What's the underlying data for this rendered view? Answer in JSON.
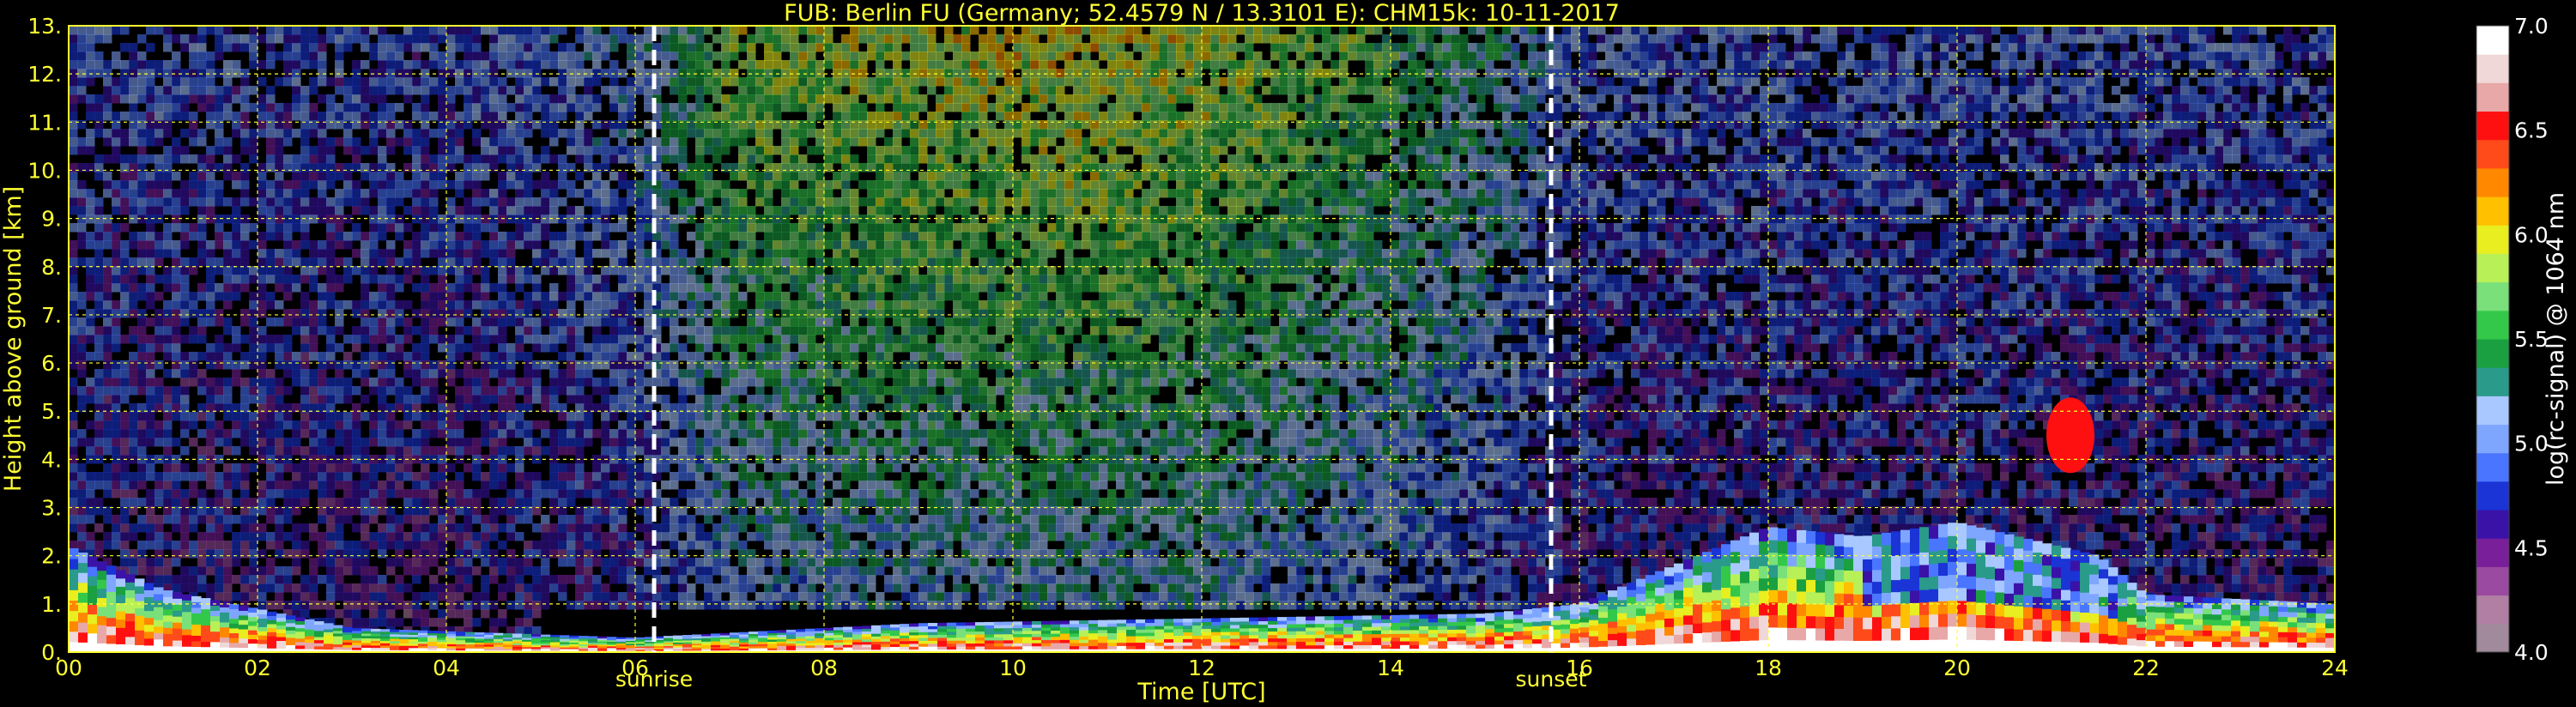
{
  "chart_data": {
    "type": "heatmap",
    "title": "FUB: Berlin FU (Germany; 52.4579 N / 13.3101 E):    CHM15k: 10-11-2017",
    "xlabel": "Time [UTC]",
    "ylabel": "Height above ground [km]",
    "xlim": [
      0,
      24
    ],
    "ylim": [
      0,
      13
    ],
    "x_ticks": [
      "00",
      "02",
      "04",
      "06",
      "08",
      "10",
      "12",
      "14",
      "16",
      "18",
      "20",
      "22",
      "24"
    ],
    "y_ticks": [
      "0.",
      "1.",
      "2.",
      "3.",
      "4.",
      "5.",
      "6.",
      "7.",
      "8.",
      "9.",
      "10.",
      "11.",
      "12.",
      "13."
    ],
    "grid": true,
    "annotations": [
      {
        "label": "sunrise",
        "x": 6.2
      },
      {
        "label": "sunset",
        "x": 15.7
      }
    ],
    "colorbar": {
      "label": "log(rc-signal) @ 1064 nm",
      "range": [
        4.0,
        7.0
      ],
      "ticks": [
        "4.0",
        "4.5",
        "5.0",
        "5.5",
        "6.0",
        "6.5",
        "7.0"
      ]
    },
    "features": {
      "noise_profile_by_hour": [
        {
          "t": 0,
          "level": 0.3
        },
        {
          "t": 4,
          "level": 0.28
        },
        {
          "t": 6,
          "level": 0.4
        },
        {
          "t": 7,
          "level": 0.78
        },
        {
          "t": 9,
          "level": 0.85
        },
        {
          "t": 11,
          "level": 0.9
        },
        {
          "t": 13,
          "level": 0.78
        },
        {
          "t": 15,
          "level": 0.55
        },
        {
          "t": 16,
          "level": 0.33
        },
        {
          "t": 24,
          "level": 0.3
        }
      ],
      "boundary_layer_top_km": [
        {
          "t": 0,
          "h": 2.2
        },
        {
          "t": 1,
          "h": 1.3
        },
        {
          "t": 3,
          "h": 0.5
        },
        {
          "t": 6,
          "h": 0.3
        },
        {
          "t": 9,
          "h": 0.6
        },
        {
          "t": 12,
          "h": 0.7
        },
        {
          "t": 15,
          "h": 0.8
        },
        {
          "t": 16,
          "h": 1.0
        },
        {
          "t": 18,
          "h": 2.6
        },
        {
          "t": 19,
          "h": 2.4
        },
        {
          "t": 20,
          "h": 2.7
        },
        {
          "t": 21.5,
          "h": 2.0
        },
        {
          "t": 22,
          "h": 1.2
        },
        {
          "t": 24,
          "h": 1.0
        }
      ],
      "cloud": {
        "t": 21.2,
        "h": 4.5,
        "value": 6.5
      }
    }
  }
}
